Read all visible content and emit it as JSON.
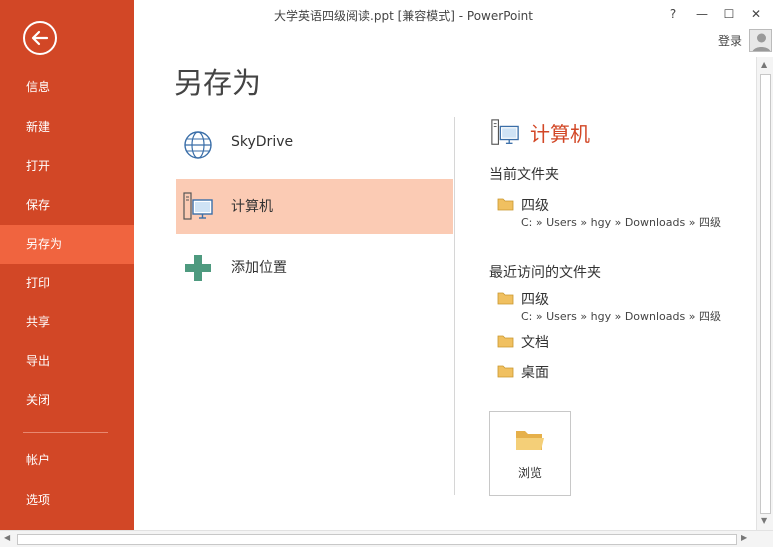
{
  "window": {
    "title": "大学英语四级阅读.ppt [兼容模式] - PowerPoint",
    "help": "?",
    "minimize": "—",
    "maximize": "☐",
    "close": "✕",
    "login": "登录"
  },
  "sidebar": {
    "items": [
      {
        "label": "信息"
      },
      {
        "label": "新建"
      },
      {
        "label": "打开"
      },
      {
        "label": "保存"
      },
      {
        "label": "另存为"
      },
      {
        "label": "打印"
      },
      {
        "label": "共享"
      },
      {
        "label": "导出"
      },
      {
        "label": "关闭"
      },
      {
        "label": "帐户"
      },
      {
        "label": "选项"
      }
    ],
    "active_index": 4
  },
  "main": {
    "title": "另存为",
    "places": [
      {
        "label": "SkyDrive",
        "icon": "globe-icon"
      },
      {
        "label": "计算机",
        "icon": "computer-icon"
      },
      {
        "label": "添加位置",
        "icon": "plus-icon"
      }
    ]
  },
  "right": {
    "title": "计算机",
    "current_heading": "当前文件夹",
    "current_folders": [
      {
        "name": "四级",
        "path": "C: » Users » hgy » Downloads » 四级"
      }
    ],
    "recent_heading": "最近访问的文件夹",
    "recent_folders": [
      {
        "name": "四级",
        "path": "C: » Users » hgy » Downloads » 四级"
      },
      {
        "name": "文档",
        "path": ""
      },
      {
        "name": "桌面",
        "path": ""
      }
    ],
    "browse_label": "浏览"
  },
  "colors": {
    "accent": "#d24726",
    "active_nav": "#f0643f",
    "active_place": "#fbcbb4",
    "folder": "#f0c060"
  }
}
